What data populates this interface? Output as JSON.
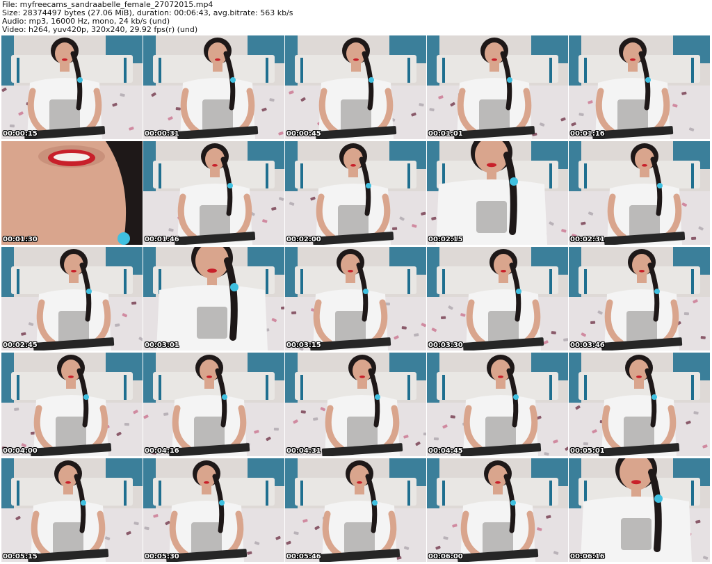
{
  "header": {
    "file": "File: myfreecams_sandraabelle_female_27072015.mp4",
    "size": "Size: 28374497 bytes (27.06 MiB), duration: 00:06:43, avg.bitrate: 563 kb/s",
    "audio": "Audio: mp3, 16000 Hz, mono, 24 kb/s (und)",
    "video": "Video: h264, yuv420p, 320x240, 29.92 fps(r) (und)"
  },
  "colors": {
    "wall": "#ded9d6",
    "curtain": "#1f6f8f",
    "headboard": "#e9e7e4",
    "bedding": "#e6e1e3",
    "shirt": "#f4f4f4",
    "skin": "#d9a58d",
    "hair": "#1e1818",
    "flower": "#3fc0e0",
    "keyboard": "#262626",
    "lips": "#c8202a"
  },
  "thumbnails": [
    {
      "timestamp": "00:00:15",
      "kind": "normal"
    },
    {
      "timestamp": "00:00:31",
      "kind": "normal"
    },
    {
      "timestamp": "00:00:45",
      "kind": "normal"
    },
    {
      "timestamp": "00:01:01",
      "kind": "normal"
    },
    {
      "timestamp": "00:01:16",
      "kind": "normal"
    },
    {
      "timestamp": "00:01:30",
      "kind": "closeup-mouth"
    },
    {
      "timestamp": "00:01:46",
      "kind": "normal"
    },
    {
      "timestamp": "00:02:00",
      "kind": "normal"
    },
    {
      "timestamp": "00:02:15",
      "kind": "closeup"
    },
    {
      "timestamp": "00:02:31",
      "kind": "normal"
    },
    {
      "timestamp": "00:02:45",
      "kind": "normal"
    },
    {
      "timestamp": "00:03:01",
      "kind": "closeup"
    },
    {
      "timestamp": "00:03:15",
      "kind": "normal"
    },
    {
      "timestamp": "00:03:30",
      "kind": "normal"
    },
    {
      "timestamp": "00:03:46",
      "kind": "normal"
    },
    {
      "timestamp": "00:04:00",
      "kind": "normal"
    },
    {
      "timestamp": "00:04:16",
      "kind": "normal"
    },
    {
      "timestamp": "00:04:31",
      "kind": "normal"
    },
    {
      "timestamp": "00:04:45",
      "kind": "normal"
    },
    {
      "timestamp": "00:05:01",
      "kind": "normal"
    },
    {
      "timestamp": "00:05:15",
      "kind": "normal"
    },
    {
      "timestamp": "00:05:30",
      "kind": "normal"
    },
    {
      "timestamp": "00:05:46",
      "kind": "normal"
    },
    {
      "timestamp": "00:06:00",
      "kind": "normal"
    },
    {
      "timestamp": "00:06:16",
      "kind": "closeup"
    }
  ]
}
